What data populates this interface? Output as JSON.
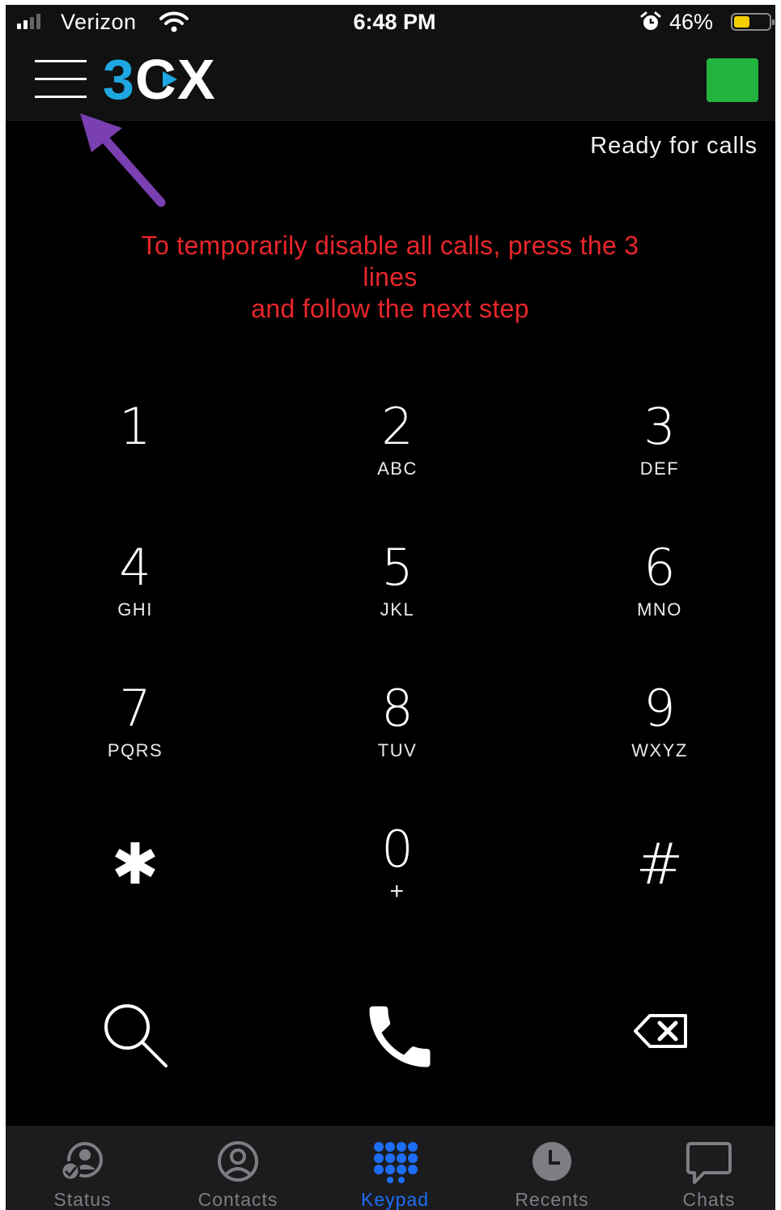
{
  "status_bar": {
    "carrier": "Verizon",
    "time": "6:48 PM",
    "battery_percent": "46%",
    "battery_level": 0.46,
    "battery_color": "#f5d000"
  },
  "header": {
    "logo_text": "3CX",
    "logo_color": "#1ea7e1",
    "presence_color": "#23b33f"
  },
  "status_text": "Ready for calls",
  "instruction": {
    "line1": "To temporarily disable all calls, press the 3",
    "line2": "lines",
    "line3": "and follow the next step",
    "color": "#e8262b"
  },
  "keypad": [
    {
      "digit": "1",
      "letters": ""
    },
    {
      "digit": "2",
      "letters": "ABC"
    },
    {
      "digit": "3",
      "letters": "DEF"
    },
    {
      "digit": "4",
      "letters": "GHI"
    },
    {
      "digit": "5",
      "letters": "JKL"
    },
    {
      "digit": "6",
      "letters": "MNO"
    },
    {
      "digit": "7",
      "letters": "PQRS"
    },
    {
      "digit": "8",
      "letters": "TUV"
    },
    {
      "digit": "9",
      "letters": "WXYZ"
    },
    {
      "digit": "✱",
      "letters": ""
    },
    {
      "digit": "0",
      "letters": "+"
    },
    {
      "digit": "#",
      "letters": ""
    }
  ],
  "actions": [
    "search-icon",
    "phone-icon",
    "backspace-icon"
  ],
  "tabs": [
    {
      "label": "Status",
      "icon": "status-icon",
      "active": false
    },
    {
      "label": "Contacts",
      "icon": "contacts-icon",
      "active": false
    },
    {
      "label": "Keypad",
      "icon": "keypad-icon",
      "active": true
    },
    {
      "label": "Recents",
      "icon": "clock-icon",
      "active": false
    },
    {
      "label": "Chats",
      "icon": "chat-icon",
      "active": false
    }
  ],
  "colors": {
    "accent": "#1d6df5",
    "annotation_arrow": "#7a3fb0",
    "inactive_tab": "#7d7d82"
  }
}
